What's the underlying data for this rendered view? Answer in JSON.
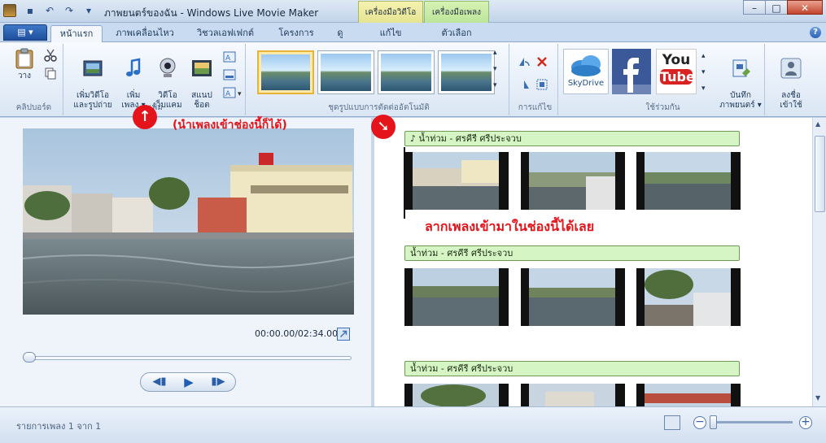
{
  "window": {
    "title": "ภาพยนตร์ของฉัน - Windows Live Movie Maker",
    "context_tabs": [
      "เครื่องมือวิดีโอ",
      "เครื่องมือเพลง"
    ]
  },
  "tabs": {
    "app_menu": "▤ ▾",
    "items": [
      "หน้าแรก",
      "ภาพเคลื่อนไหว",
      "วิชวลเอฟเฟกต์",
      "โครงการ",
      "ดู",
      "แก้ไข",
      "ตัวเลือก"
    ],
    "active": "หน้าแรก"
  },
  "ribbon": {
    "clipboard": {
      "label": "คลิปบอร์ด",
      "paste": "วาง"
    },
    "add": {
      "label": "เพิ่ม",
      "add_videos_photos": "เพิ่มวิดีโอ\nและรูปถ่าย",
      "add_music": "เพิ่ม\nเพลง ▾",
      "webcam_video": "วิดีโอ\nเว็บแคม",
      "snapshot": "สแนป\nช็อต"
    },
    "themes": {
      "label": "ชุดรูปแบบการตัดต่ออัตโนมัติ"
    },
    "editing": {
      "label": "การแก้ไข"
    },
    "sharing": {
      "label": "ใช้ร่วมกัน",
      "skydrive": "SkyDrive",
      "youtube_you": "You",
      "youtube_tube": "Tube",
      "save_movie": "บันทึก\nภาพยนตร์ ▾",
      "sign_in": "ลงชื่อ\nเข้าใช้"
    }
  },
  "preview": {
    "time": "00:00.00/02:34.00"
  },
  "storyboard": {
    "music_items": [
      "♪ น้ำท่วม - ศรคีรี ศรีประจวบ",
      "น้ำท่วม - ศรคีรี ศรีประจวบ",
      "น้ำท่วม - ศรคีรี ศรีประจวบ"
    ]
  },
  "annotations": {
    "add_music_hint": "(นำเพลงเข้าช่องนี้ก็ได้)",
    "drag_hint": "ลากเพลงเข้ามาในช่องนี้ได้เลย"
  },
  "status": {
    "text": "รายการเพลง 1 จาก 1"
  }
}
